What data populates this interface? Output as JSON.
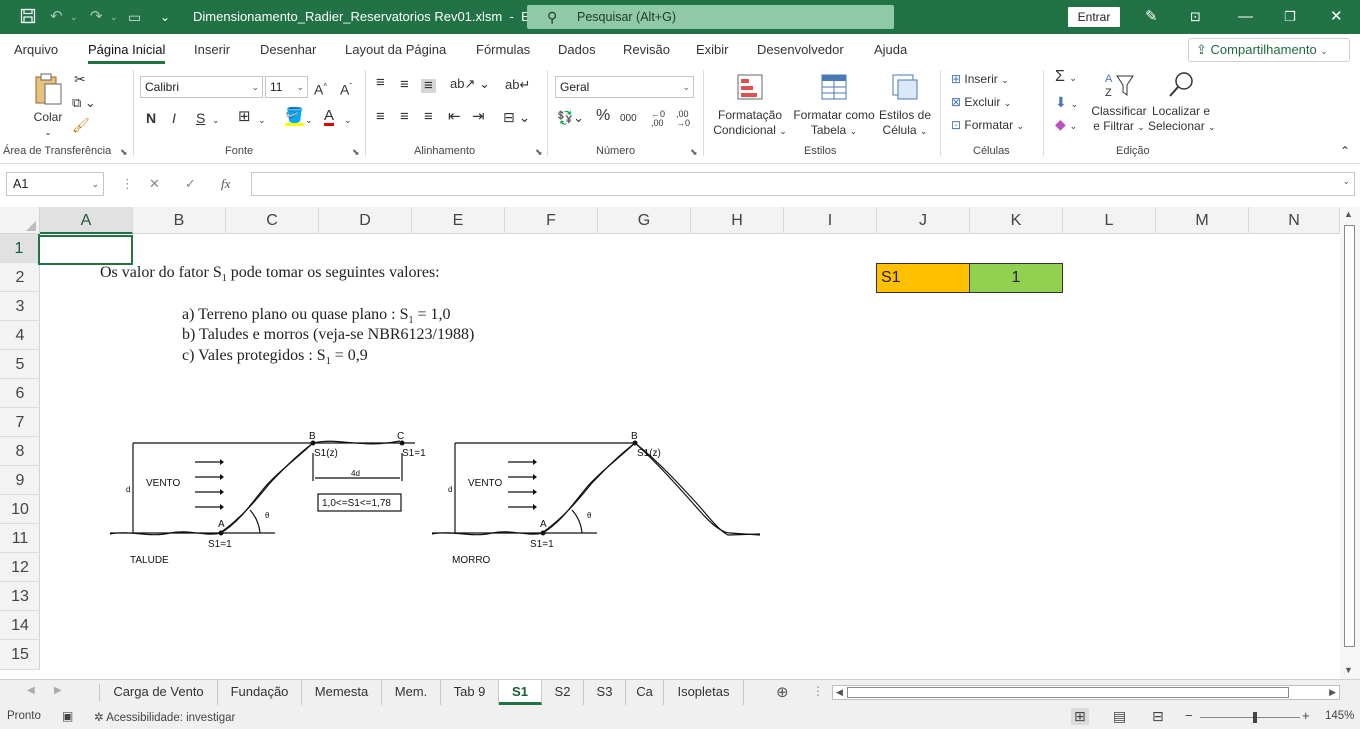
{
  "titlebar": {
    "filename": "Dimensionamento_Radier_Reservatorios Rev01.xlsm",
    "separator": "-",
    "app": "Excel",
    "search_placeholder": "Pesquisar (Alt+G)",
    "signin_label": "Entrar"
  },
  "menu": {
    "tabs": [
      "Arquivo",
      "Página Inicial",
      "Inserir",
      "Desenhar",
      "Layout da Página",
      "Fórmulas",
      "Dados",
      "Revisão",
      "Exibir",
      "Desenvolvedor",
      "Ajuda"
    ],
    "active": "Página Inicial",
    "share_label": "Compartilhamento"
  },
  "ribbon": {
    "clipboard": {
      "paste_label": "Colar",
      "group": "Área de Transferência"
    },
    "font": {
      "name": "Calibri",
      "size": "11",
      "bold": "N",
      "italic": "I",
      "underline": "S",
      "group": "Fonte"
    },
    "alignment": {
      "group": "Alinhamento"
    },
    "number": {
      "format": "Geral",
      "group": "Número"
    },
    "styles": {
      "conditional": [
        "Formatação",
        "Condicional"
      ],
      "table": [
        "Formatar como",
        "Tabela"
      ],
      "cell": [
        "Estilos de",
        "Célula"
      ],
      "group": "Estilos"
    },
    "cells": {
      "insert": "Inserir",
      "delete": "Excluir",
      "format": "Formatar",
      "group": "Células"
    },
    "editing": {
      "sort": [
        "Classificar",
        "e Filtrar"
      ],
      "find": [
        "Localizar e",
        "Selecionar"
      ],
      "group": "Edição"
    }
  },
  "formula_bar": {
    "name_box": "A1",
    "fx": "fx",
    "value": ""
  },
  "columns": [
    "A",
    "B",
    "C",
    "D",
    "E",
    "F",
    "G",
    "H",
    "I",
    "J",
    "K",
    "L",
    "M",
    "N"
  ],
  "rows": [
    "1",
    "2",
    "3",
    "4",
    "5",
    "6",
    "7",
    "8",
    "9",
    "10",
    "11",
    "12",
    "13",
    "14",
    "15"
  ],
  "cells": {
    "J2": "S1",
    "K2": "1"
  },
  "image": {
    "heading": "Os valor do fator S",
    "heading_sub": "1",
    "heading_tail": " pode tomar os seguintes valores:",
    "item_a": "a)   Terreno plano ou quase plano : S",
    "item_a_sub": "1",
    "item_a_tail": " = 1,0",
    "item_b": "b)   Taludes e morros (veja-se NBR6123/1988)",
    "item_c": "c)   Vales protegidos : S",
    "item_c_sub": "1",
    "item_c_tail": " = 0,9",
    "talude": {
      "vento": "VENTO",
      "label": "TALUDE",
      "s1z": "S1(z)",
      "s1_base": "S1=1",
      "s1_top": "S1=1",
      "dist": "4d",
      "range": "1,0<=S1<=1,78",
      "a": "A",
      "b": "B",
      "c": "C",
      "d": "d",
      "theta": "θ"
    },
    "morro": {
      "vento": "VENTO",
      "label": "MORRO",
      "s1z": "S1(z)",
      "s1_base": "S1=1",
      "a": "A",
      "b": "B",
      "d": "d",
      "theta": "θ"
    }
  },
  "sheets": [
    "Carga de Vento",
    "Fundação",
    "Memesta",
    "Mem.",
    "Tab 9",
    "S1",
    "S2",
    "S3",
    "Ca",
    "Isopletas"
  ],
  "active_sheet": "S1",
  "status": {
    "ready": "Pronto",
    "accessibility": "Acessibilidade: investigar",
    "zoom": "145%"
  },
  "colors": {
    "accent": "#217346",
    "s1_label_bg": "#ffc000",
    "s1_value_bg": "#92d050"
  }
}
